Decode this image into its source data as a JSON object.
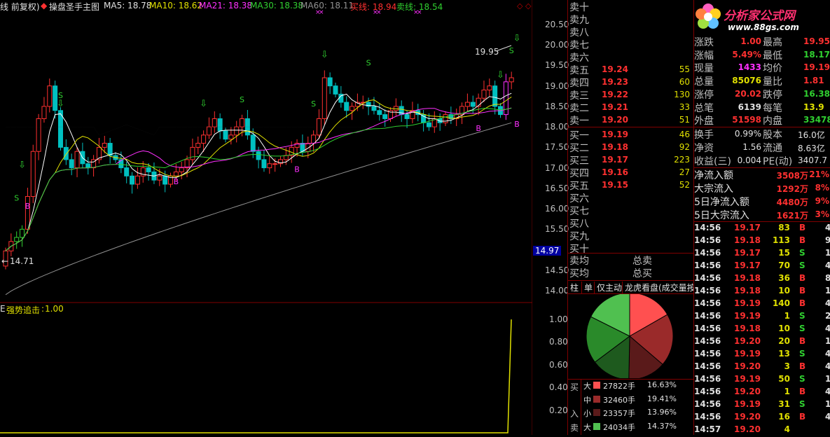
{
  "header": {
    "prefix": "线 前复权)",
    "title": "操盘圣手主图",
    "ma5": "MA5: 18.78",
    "ma10": "MA10: 18.62",
    "ma21": "MA21: 18.38",
    "ma30": "MA30: 18.38",
    "ma60": "MA60: 18.11",
    "sell_line": "买线: 18.94",
    "buy_line": "卖线: 18.54"
  },
  "price_axis": [
    "20.50",
    "20.00",
    "19.50",
    "19.00",
    "18.50",
    "18.00",
    "17.50",
    "17.00",
    "16.50",
    "16.00",
    "15.50",
    "14.97",
    "14.50",
    "14.00"
  ],
  "price_marks": {
    "high": "19.95",
    "low": "14.71",
    "current": "14.97"
  },
  "indicator": {
    "name": "强势追击",
    "value": "1.00",
    "prefix": "E",
    "axis": [
      "1.00",
      "0.80",
      "0.60",
      "0.40",
      "0.20"
    ]
  },
  "signals": {
    "buy": "B",
    "sell": "S"
  },
  "logo": {
    "name": "分析家公式网",
    "url": "www.88gs.com"
  },
  "orderbook": {
    "sells": [
      {
        "label": "卖十",
        "price": "",
        "vol": ""
      },
      {
        "label": "卖九",
        "price": "",
        "vol": ""
      },
      {
        "label": "卖八",
        "price": "",
        "vol": ""
      },
      {
        "label": "卖七",
        "price": "",
        "vol": ""
      },
      {
        "label": "卖六",
        "price": "",
        "vol": ""
      },
      {
        "label": "卖五",
        "price": "19.24",
        "vol": "55"
      },
      {
        "label": "卖四",
        "price": "19.23",
        "vol": "60"
      },
      {
        "label": "卖三",
        "price": "19.22",
        "vol": "130"
      },
      {
        "label": "卖二",
        "price": "19.21",
        "vol": "33"
      },
      {
        "label": "卖一",
        "price": "19.20",
        "vol": "51"
      }
    ],
    "buys": [
      {
        "label": "买一",
        "price": "19.19",
        "vol": "46"
      },
      {
        "label": "买二",
        "price": "19.18",
        "vol": "92"
      },
      {
        "label": "买三",
        "price": "19.17",
        "vol": "223"
      },
      {
        "label": "买四",
        "price": "19.16",
        "vol": "27"
      },
      {
        "label": "买五",
        "price": "19.15",
        "vol": "52"
      },
      {
        "label": "买六",
        "price": "",
        "vol": ""
      },
      {
        "label": "买七",
        "price": "",
        "vol": ""
      },
      {
        "label": "买八",
        "price": "",
        "vol": ""
      },
      {
        "label": "买九",
        "price": "",
        "vol": ""
      },
      {
        "label": "买十",
        "price": "",
        "vol": ""
      }
    ],
    "avg_sell": "卖均",
    "avg_buy": "买均",
    "total_sell": "总卖",
    "total_buy": "总买",
    "tabs": [
      "柱",
      "单",
      "仅主动",
      "龙虎看盘(成交量按"
    ]
  },
  "flow": {
    "side_labels": [
      "买",
      "入",
      "卖"
    ],
    "rows": [
      {
        "size": "大",
        "vol": "27822手",
        "pct": "16.63%",
        "color": "#ff5050"
      },
      {
        "size": "中",
        "vol": "32460手",
        "pct": "19.41%",
        "color": "#9a2a2a"
      },
      {
        "size": "小",
        "vol": "23357手",
        "pct": "13.96%",
        "color": "#5a1a1a"
      },
      {
        "size": "大",
        "vol": "24034手",
        "pct": "14.37%",
        "color": "#50c050"
      }
    ],
    "pie": [
      {
        "value": 16.63,
        "color": "#ff5050"
      },
      {
        "value": 19.41,
        "color": "#9a2a2a"
      },
      {
        "value": 13.96,
        "color": "#5a1a1a"
      },
      {
        "value": 14.37,
        "color": "#1e5a1e"
      },
      {
        "value": 17.5,
        "color": "#2a8a2a"
      },
      {
        "value": 17.5,
        "color": "#50c050"
      }
    ]
  },
  "quotes": [
    {
      "l1": "涨跌",
      "v1": "1.00",
      "l2": "最高",
      "v2": "19.95"
    },
    {
      "l1": "涨幅",
      "v1": "5.49%",
      "l2": "最低",
      "v2": "18.17"
    },
    {
      "l1": "现量",
      "v1": "1433",
      "l2": "均价",
      "v2": "19.19"
    },
    {
      "l1": "总量",
      "v1": "85076",
      "l2": "量比",
      "v2": "1.81"
    },
    {
      "l1": "涨停",
      "v1": "20.02",
      "l2": "跌停",
      "v2": "16.38"
    },
    {
      "l1": "总笔",
      "v1": "6139",
      "l2": "每笔",
      "v2": "13.9"
    },
    {
      "l1": "外盘",
      "v1": "51598",
      "l2": "内盘",
      "v2": "33478"
    }
  ],
  "quotes2": [
    {
      "l1": "换手",
      "v1": "0.99%",
      "l2": "股本",
      "v2": "16.0亿"
    },
    {
      "l1": "净资",
      "v1": "1.56",
      "l2": "流通",
      "v2": "8.63亿"
    },
    {
      "l1": "收益(三)",
      "v1": "0.004",
      "l2": "PE(动)",
      "v2": "3407.7"
    }
  ],
  "fund_flow": [
    {
      "label": "净流入额",
      "value": "3508万",
      "pct": "21%"
    },
    {
      "label": "大宗流入",
      "value": "1292万",
      "pct": "8%"
    },
    {
      "label": "5日净流入额",
      "value": "4480万",
      "pct": "9%"
    },
    {
      "label": "5日大宗流入",
      "value": "1621万",
      "pct": "3%"
    }
  ],
  "ticks": [
    {
      "t": "14:56",
      "p": "19.17",
      "v": "83",
      "s": "B"
    },
    {
      "t": "14:56",
      "p": "19.18",
      "v": "113",
      "s": "B"
    },
    {
      "t": "14:56",
      "p": "19.17",
      "v": "15",
      "s": "S"
    },
    {
      "t": "14:56",
      "p": "19.17",
      "v": "70",
      "s": "S"
    },
    {
      "t": "14:56",
      "p": "19.18",
      "v": "36",
      "s": "B"
    },
    {
      "t": "14:56",
      "p": "19.18",
      "v": "10",
      "s": "B"
    },
    {
      "t": "14:56",
      "p": "19.19",
      "v": "140",
      "s": "B"
    },
    {
      "t": "14:56",
      "p": "19.19",
      "v": "1",
      "s": "S"
    },
    {
      "t": "14:56",
      "p": "19.18",
      "v": "10",
      "s": "S"
    },
    {
      "t": "14:56",
      "p": "19.20",
      "v": "20",
      "s": "B"
    },
    {
      "t": "14:56",
      "p": "19.19",
      "v": "13",
      "s": "S"
    },
    {
      "t": "14:56",
      "p": "19.20",
      "v": "3",
      "s": "B"
    },
    {
      "t": "14:56",
      "p": "19.19",
      "v": "50",
      "s": "S"
    },
    {
      "t": "14:56",
      "p": "19.20",
      "v": "1",
      "s": "B"
    },
    {
      "t": "14:56",
      "p": "19.19",
      "v": "31",
      "s": "S"
    },
    {
      "t": "14:56",
      "p": "19.20",
      "v": "16",
      "s": "B"
    },
    {
      "t": "14:57",
      "p": "19.20",
      "v": "4",
      "s": ""
    }
  ],
  "tick_side_right": [
    "4",
    "9",
    "1",
    "4",
    "8",
    "1",
    "4",
    "2",
    "4",
    "1",
    "4",
    "4",
    "1",
    "4",
    "1",
    "4",
    ""
  ],
  "colors": {
    "up": "#ff3030",
    "down": "#00c0c0",
    "grid": "#800000",
    "yellow": "#e0e000",
    "green": "#30d030",
    "magenta": "#ff30ff"
  }
}
